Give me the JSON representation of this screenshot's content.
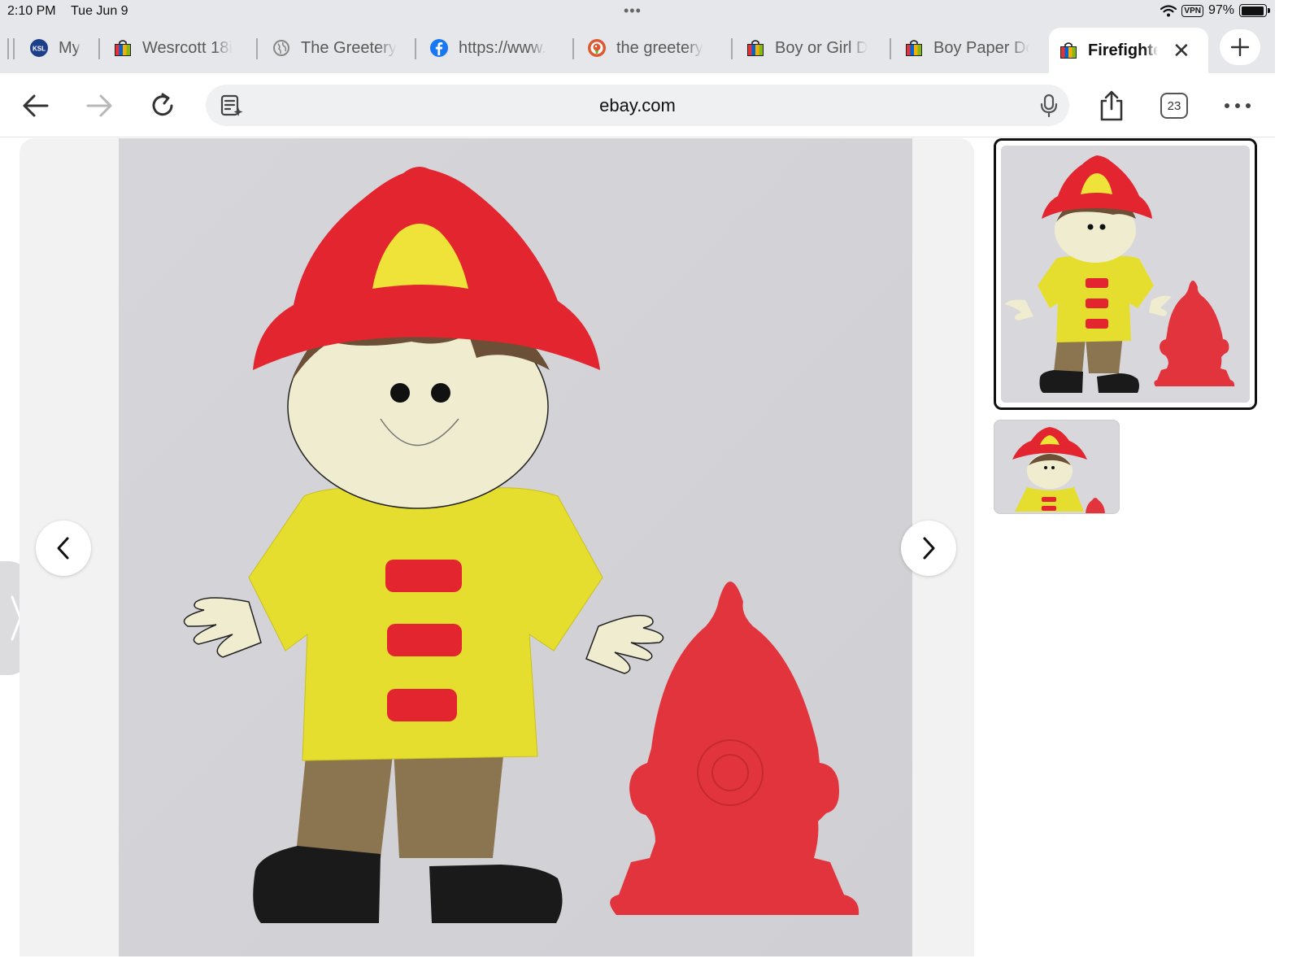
{
  "status_bar": {
    "time": "2:10 PM",
    "date": "Tue Jun 9",
    "vpn": "VPN",
    "battery": "97%",
    "battery_level": 0.97
  },
  "tabs": [
    {
      "label": "My",
      "icon": "ksl-icon"
    },
    {
      "label": "Wesrcott 18i",
      "icon": "ebay-bag-icon"
    },
    {
      "label": "The Greetery",
      "icon": "globe-icon"
    },
    {
      "label": "https://www.",
      "icon": "facebook-icon"
    },
    {
      "label": "the greetery",
      "icon": "duckduckgo-icon"
    },
    {
      "label": "Boy or Girl D",
      "icon": "ebay-bag-icon"
    },
    {
      "label": "Boy Paper Do",
      "icon": "ebay-bag-icon"
    },
    {
      "label": "Firefighte",
      "icon": "ebay-bag-icon",
      "active": true
    }
  ],
  "toolbar": {
    "url": "ebay.com",
    "tab_count": "23"
  },
  "colors": {
    "helmet_red": "#e2252e",
    "helmet_yellow": "#efe33a",
    "jacket_yellow": "#e6de2e",
    "skin": "#f0ecd0",
    "hair": "#6b4f36",
    "pants": "#8b7550",
    "boots": "#1a1a1a",
    "hydrant_red": "#e2343c"
  }
}
